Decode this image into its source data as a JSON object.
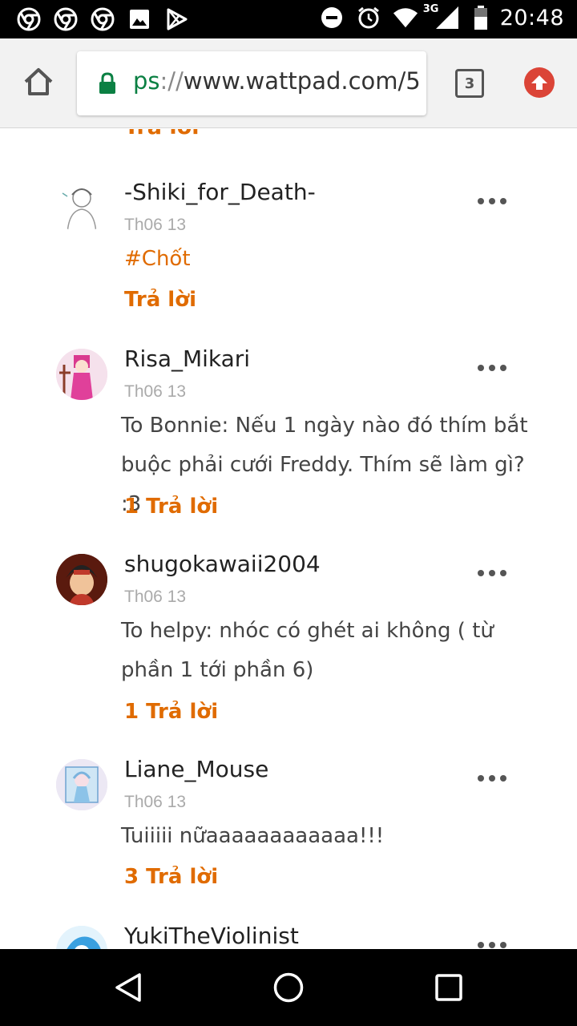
{
  "status_bar": {
    "time": "20:48",
    "network": "3G",
    "left_icons": [
      "chrome-icon",
      "chrome-icon",
      "chrome-icon",
      "image-icon",
      "play-store-icon"
    ],
    "right_icons": [
      "do-not-disturb-icon",
      "alarm-icon",
      "wifi-icon",
      "signal-icon",
      "battery-icon"
    ]
  },
  "browser": {
    "url_scheme": "ps",
    "url_sep": "://",
    "url_host": "www.wattpad.com/5",
    "tab_count": "3",
    "colors": {
      "lock": "#0b8043",
      "update": "#db4437"
    }
  },
  "comments": {
    "top_reply": "Trả lời",
    "items": [
      {
        "username": "-Shiki_for_Death-",
        "date": "Th06 13",
        "text": "#Chốt",
        "reply": "Trả lời"
      },
      {
        "username": "Risa_Mikari",
        "date": "Th06 13",
        "text": "To Bonnie: Nếu 1 ngày nào đó thím bắt buộc phải cưới Freddy. Thím sẽ làm gì? :3",
        "reply": "1 Trả lời"
      },
      {
        "username": "shugokawaii2004",
        "date": "Th06 13",
        "text": "To helpy: nhóc có ghét ai không ( từ phần 1 tới phần 6)",
        "reply": "1 Trả lời"
      },
      {
        "username": "Liane_Mouse",
        "date": "Th06 13",
        "text": "Tuiiiii nữaaaaaaaaaaaa!!!",
        "reply": "3 Trả lời"
      },
      {
        "username": "YukiTheViolinist"
      }
    ],
    "accent_color": "#e06b00"
  },
  "nav_bar": {
    "icons": [
      "back-icon",
      "home-icon",
      "recents-icon"
    ]
  }
}
